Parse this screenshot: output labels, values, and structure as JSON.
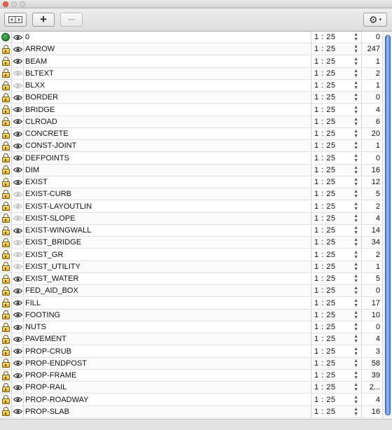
{
  "window": {
    "controls": [
      "close",
      "minimize",
      "maximize"
    ]
  },
  "toolbar": {
    "split_icon": "split-view-icon",
    "add_label": "+",
    "remove_label": "−",
    "gear_icon": "gear-icon",
    "gear_caret": "▾"
  },
  "layers": [
    {
      "name": "0",
      "scale": "1 : 25",
      "count": "0",
      "current": true,
      "visible": true
    },
    {
      "name": "ARROW",
      "scale": "1 : 25",
      "count": "247",
      "visible": true
    },
    {
      "name": "BEAM",
      "scale": "1 : 25",
      "count": "1",
      "visible": true
    },
    {
      "name": "BLTEXT",
      "scale": "1 : 25",
      "count": "2",
      "visible": false
    },
    {
      "name": "BLXX",
      "scale": "1 : 25",
      "count": "1",
      "visible": false
    },
    {
      "name": "BORDER",
      "scale": "1 : 25",
      "count": "0",
      "visible": true
    },
    {
      "name": "BRIDGE",
      "scale": "1 : 25",
      "count": "4",
      "visible": true
    },
    {
      "name": "CLROAD",
      "scale": "1 : 25",
      "count": "6",
      "visible": true
    },
    {
      "name": "CONCRETE",
      "scale": "1 : 25",
      "count": "20",
      "visible": true
    },
    {
      "name": "CONST-JOINT",
      "scale": "1 : 25",
      "count": "1",
      "visible": true
    },
    {
      "name": "DEFPOINTS",
      "scale": "1 : 25",
      "count": "0",
      "visible": true
    },
    {
      "name": "DIM",
      "scale": "1 : 25",
      "count": "16",
      "visible": true
    },
    {
      "name": "EXIST",
      "scale": "1 : 25",
      "count": "12",
      "visible": true
    },
    {
      "name": "EXIST-CURB",
      "scale": "1 : 25",
      "count": "5",
      "visible": false
    },
    {
      "name": "EXIST-LAYOUTLIN",
      "scale": "1 : 25",
      "count": "2",
      "visible": false
    },
    {
      "name": "EXIST-SLOPE",
      "scale": "1 : 25",
      "count": "4",
      "visible": false
    },
    {
      "name": "EXIST-WINGWALL",
      "scale": "1 : 25",
      "count": "14",
      "visible": true
    },
    {
      "name": "EXIST_BRIDGE",
      "scale": "1 : 25",
      "count": "34",
      "visible": false
    },
    {
      "name": "EXIST_GR",
      "scale": "1 : 25",
      "count": "2",
      "visible": false
    },
    {
      "name": "EXIST_UTILITY",
      "scale": "1 : 25",
      "count": "1",
      "visible": false
    },
    {
      "name": "EXIST_WATER",
      "scale": "1 : 25",
      "count": "5",
      "visible": true
    },
    {
      "name": "FED_AID_BOX",
      "scale": "1 : 25",
      "count": "0",
      "visible": true
    },
    {
      "name": "FILL",
      "scale": "1 : 25",
      "count": "17",
      "visible": true
    },
    {
      "name": "FOOTING",
      "scale": "1 : 25",
      "count": "10",
      "visible": true
    },
    {
      "name": "NUTS",
      "scale": "1 : 25",
      "count": "0",
      "visible": true
    },
    {
      "name": "PAVEMENT",
      "scale": "1 : 25",
      "count": "4",
      "visible": true
    },
    {
      "name": "PROP-CRUB",
      "scale": "1 : 25",
      "count": "3",
      "visible": true
    },
    {
      "name": "PROP-ENDPOST",
      "scale": "1 : 25",
      "count": "58",
      "visible": true
    },
    {
      "name": "PROP-FRAME",
      "scale": "1 : 25",
      "count": "39",
      "visible": true
    },
    {
      "name": "PROP-RAIL",
      "scale": "1 : 25",
      "count": "2...",
      "visible": true
    },
    {
      "name": "PROP-ROADWAY",
      "scale": "1 : 25",
      "count": "4",
      "visible": true
    },
    {
      "name": "PROP-SLAB",
      "scale": "1 : 25",
      "count": "16",
      "visible": true
    }
  ],
  "icons": {
    "lock": "lock-icon",
    "eye": "eye-icon",
    "current_layer": "current-layer-dot",
    "stepper": "stepper-arrows-icon"
  },
  "colors": {
    "current_dot": "#1f7a2a",
    "scroll_thumb": "#4d7fd6",
    "eye_visible": "#222222",
    "eye_hidden": "#b5b5b5"
  }
}
